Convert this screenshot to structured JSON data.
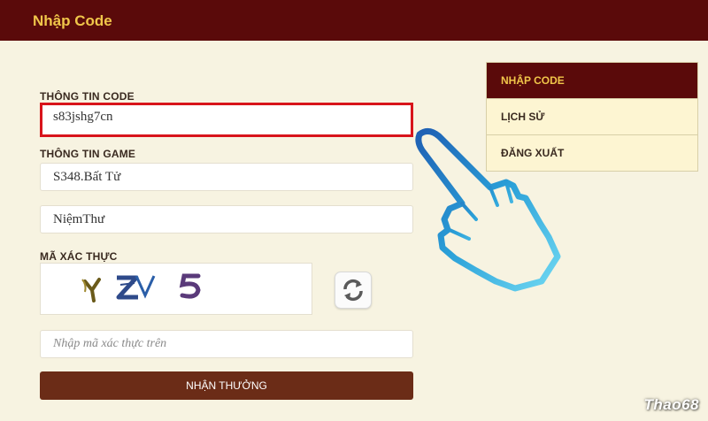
{
  "header": {
    "title": "Nhập Code"
  },
  "form": {
    "code_label": "THÔNG TIN CODE",
    "code_value": "s83jshg7cn",
    "game_label": "THÔNG TIN GAME",
    "server_value": "S348.Bất Tử",
    "character_value": "NiệmThư",
    "captcha_label": "MÃ XÁC THỰC",
    "captcha_text": "YZV 5",
    "captcha_placeholder": "Nhập mã xác thực trên",
    "submit_label": "NHẬN THƯỞNG"
  },
  "menu": {
    "items": [
      {
        "label": "NHẬP CODE",
        "active": true
      },
      {
        "label": "LỊCH SỬ",
        "active": false
      },
      {
        "label": "ĐĂNG XUẤT",
        "active": false
      }
    ]
  },
  "watermark": "Thao68",
  "colors": {
    "header_bg": "#5a0a0a",
    "accent_gold": "#f0c64a",
    "highlight_red": "#d8141b",
    "button_brown": "#6b2c17",
    "page_bg": "#f7f3e1"
  },
  "icons": {
    "refresh": "refresh-icon",
    "pointer": "pointing-hand-icon"
  }
}
